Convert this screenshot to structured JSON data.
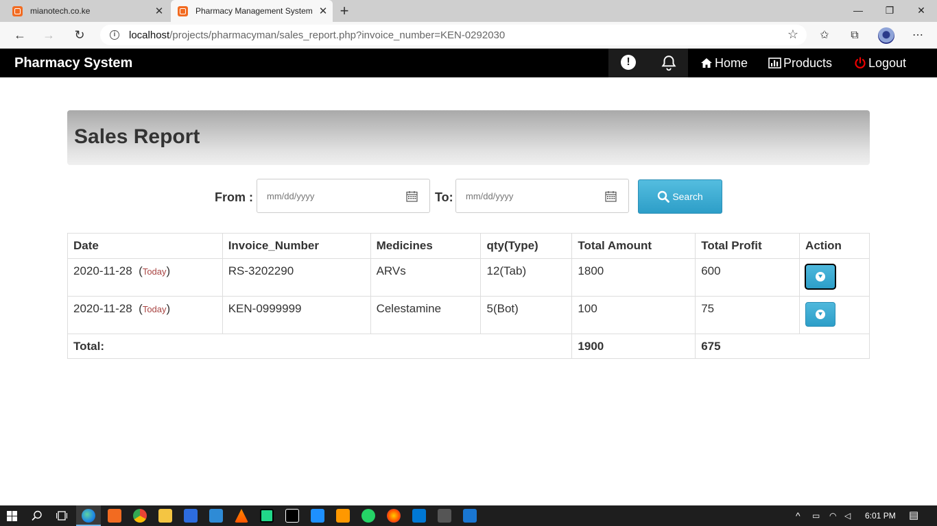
{
  "browser": {
    "tabs": [
      {
        "title": "mianotech.co.ke",
        "active": false
      },
      {
        "title": "Pharmacy Management System",
        "active": true
      }
    ],
    "url_host": "localhost",
    "url_path": "/projects/pharmacyman/sales_report.php?invoice_number=KEN-0292030"
  },
  "nav": {
    "brand": "Pharmacy System",
    "home": "Home",
    "products": "Products",
    "logout": "Logout"
  },
  "page": {
    "title": "Sales Report"
  },
  "filter": {
    "from_label": "From :",
    "to_label": "To:",
    "date_placeholder": "mm/dd/yyyy",
    "search_label": "Search"
  },
  "table": {
    "headers": [
      "Date",
      "Invoice_Number",
      "Medicines",
      "qty(Type)",
      "Total Amount",
      "Total Profit",
      "Action"
    ],
    "rows": [
      {
        "date": "2020-11-28",
        "today": "Today",
        "invoice": "RS-3202290",
        "medicine": "ARVs",
        "qty": "12(Tab)",
        "amount": "1800",
        "profit": "600"
      },
      {
        "date": "2020-11-28",
        "today": "Today",
        "invoice": "KEN-0999999",
        "medicine": "Celestamine",
        "qty": "5(Bot)",
        "amount": "100",
        "profit": "75"
      }
    ],
    "total_label": "Total:",
    "total_amount": "1900",
    "total_profit": "675"
  },
  "taskbar": {
    "time": "6:01 PM"
  },
  "colors": {
    "accent": "#31a2cc",
    "navbar": "#000000",
    "today": "#a94442"
  }
}
